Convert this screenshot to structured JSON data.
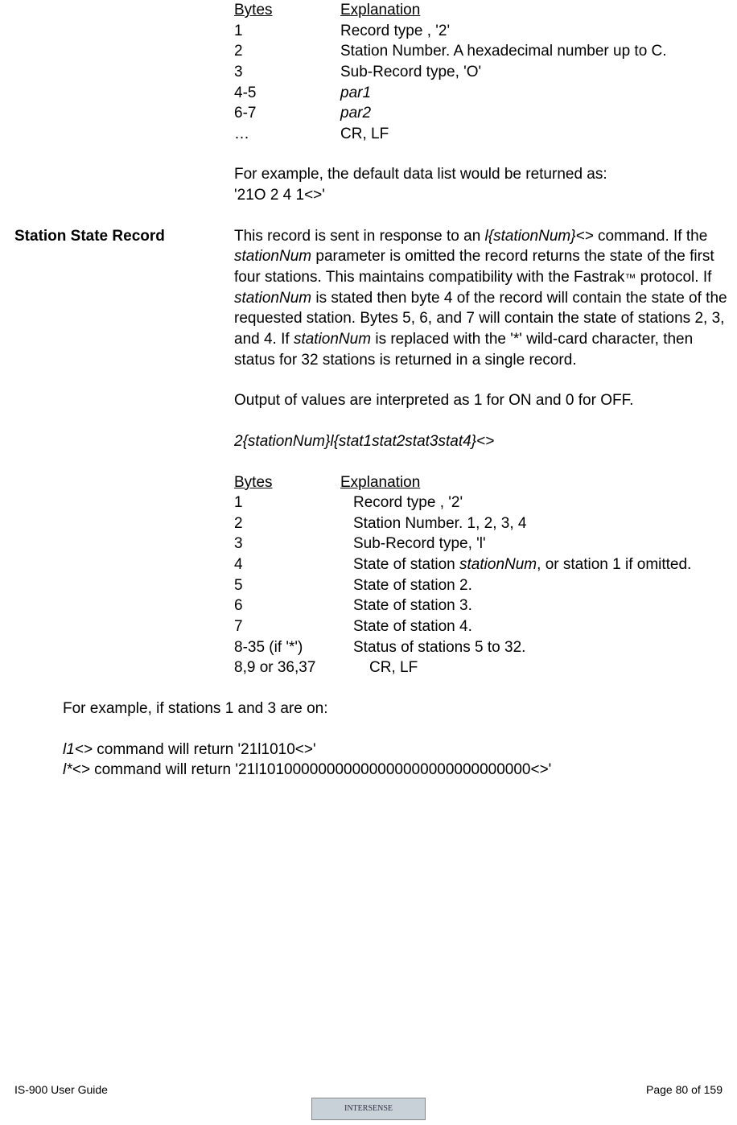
{
  "table1": {
    "headerBytes": "Bytes",
    "headerExpl": "Explanation",
    "r1b": "1",
    "r1e": "Record type , '2'",
    "r2b": "2",
    "r2e": "Station Number. A hexadecimal number up to C.",
    "r3b": "3",
    "r3e": "Sub-Record type, 'O'",
    "r4b": "4-5",
    "r4e": "par1",
    "r5b": "6-7",
    "r5e": "par2",
    "r6b": "…",
    "r6e": "CR, LF"
  },
  "example1a": "For example, the default data list would be returned as:",
  "example1b": "'21O 2 4 1<>'",
  "section2Label": "Station State Record",
  "p2a": "This record is sent in response to an ",
  "p2a_i": "l{stationNum}<>",
  "p2b": " command.  If the ",
  "p2b_i": "stationNum",
  "p2c": " parameter is omitted the record returns the state of the first four stations.  This maintains compatibility with the Fastrak",
  "p2c_tm": "™",
  "p2d": " protocol.  If ",
  "p2d_i": "stationNum",
  "p2e": " is stated then byte 4 of the record will contain the state of the requested station.  Bytes 5, 6, and 7 will contain the state of stations 2, 3, and 4.  If ",
  "p2e_i": "stationNum",
  "p2f": " is replaced with the '*' wild-card character, then status for 32 stations is returned in a single record.",
  "p3": "Output of values are interpreted as 1 for ON and 0 for OFF.",
  "p4": "2{stationNum}l{stat1stat2stat3stat4}<>",
  "table2": {
    "headerBytes": "Bytes",
    "headerExpl": "Explanation",
    "r1b": "1",
    "r1e": "Record type , '2'",
    "r2b": "2",
    "r2e": "Station Number. 1, 2, 3, 4",
    "r3b": "3",
    "r3e": "Sub-Record type, 'l'",
    "r4b": "4",
    "r4ea": "State of station ",
    "r4eb": "stationNum",
    "r4ec": ", or station 1 if omitted.",
    "r5b": "5",
    "r5e": "State of station 2.",
    "r6b": "6",
    "r6e": "State of station 3.",
    "r7b": "7",
    "r7e": "State of station 4.",
    "r8b": "8-35 (if '*')",
    "r8e": "Status of stations 5 to 32.",
    "r9b": "8,9 or 36,37",
    "r9e": "CR, LF"
  },
  "example2a": "For example, if stations 1 and 3 are on:",
  "ex2l1a": "l1<>",
  "ex2l1b": " command will return '21l1010<>'",
  "ex2l2a": "l*<>",
  "ex2l2b": " command will return '21l10100000000000000000000000000000<>'",
  "footerLeft": "IS-900 User Guide",
  "footerRight": "Page 80 of 159",
  "logo": "INTERSENSE"
}
